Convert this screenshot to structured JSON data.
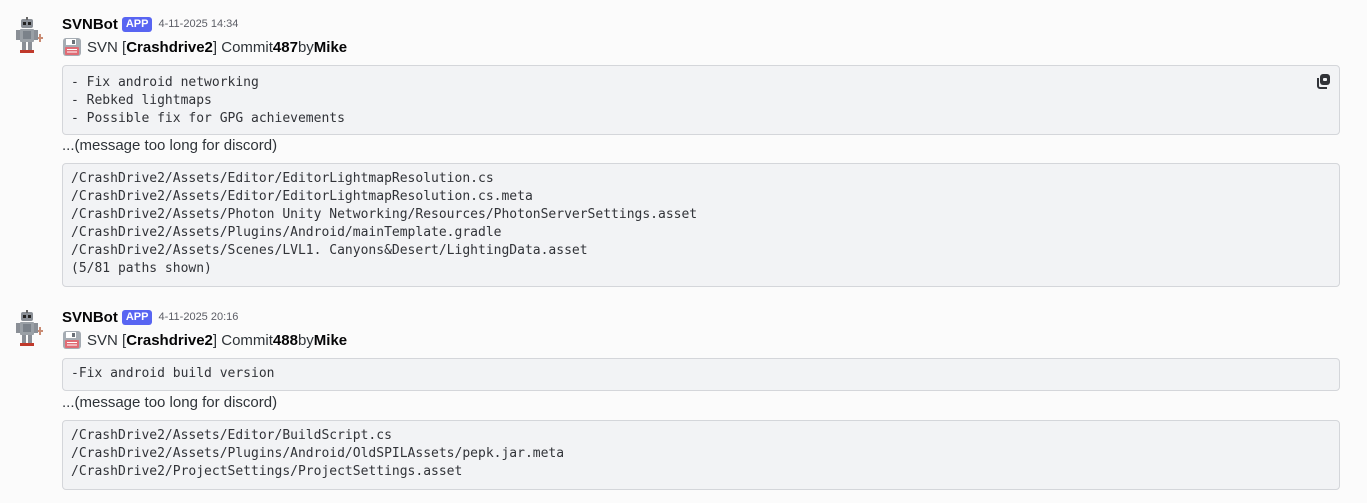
{
  "messages": [
    {
      "username": "SVNBot",
      "tag": "APP",
      "timestamp": "4-11-2025 14:34",
      "prefix": "SVN [",
      "repo": "Crashdrive2",
      "mid1": "] Commit ",
      "commit": "487",
      "mid2": " by ",
      "author": "Mike",
      "log_lines": [
        "- Fix android networking",
        "- Rebked lightmaps",
        "- Possible fix for GPG achievements"
      ],
      "note": "...(message too long for discord)",
      "path_lines": [
        "/CrashDrive2/Assets/Editor/EditorLightmapResolution.cs",
        "/CrashDrive2/Assets/Editor/EditorLightmapResolution.cs.meta",
        "/CrashDrive2/Assets/Photon Unity Networking/Resources/PhotonServerSettings.asset",
        "/CrashDrive2/Assets/Plugins/Android/mainTemplate.gradle",
        "/CrashDrive2/Assets/Scenes/LVL1. Canyons&Desert/LightingData.asset",
        "(5/81 paths shown)"
      ]
    },
    {
      "username": "SVNBot",
      "tag": "APP",
      "timestamp": "4-11-2025 20:16",
      "prefix": "SVN [",
      "repo": "Crashdrive2",
      "mid1": "] Commit ",
      "commit": "488",
      "mid2": " by ",
      "author": "Mike",
      "log_lines": [
        "-Fix android build version"
      ],
      "note": "...(message too long for discord)",
      "path_lines": [
        "/CrashDrive2/Assets/Editor/BuildScript.cs",
        "/CrashDrive2/Assets/Plugins/Android/OldSPILAssets/pepk.jar.meta",
        "/CrashDrive2/ProjectSettings/ProjectSettings.asset"
      ]
    }
  ],
  "colors": {
    "background": "#fbfbfb",
    "app_tag": "#5865f2",
    "code_bg": "#f2f3f5",
    "code_border": "#d4d6da"
  },
  "icons": {
    "avatar": "robot-avatar",
    "message_emoji": "floppy-disk-icon",
    "copy": "copy-icon"
  }
}
